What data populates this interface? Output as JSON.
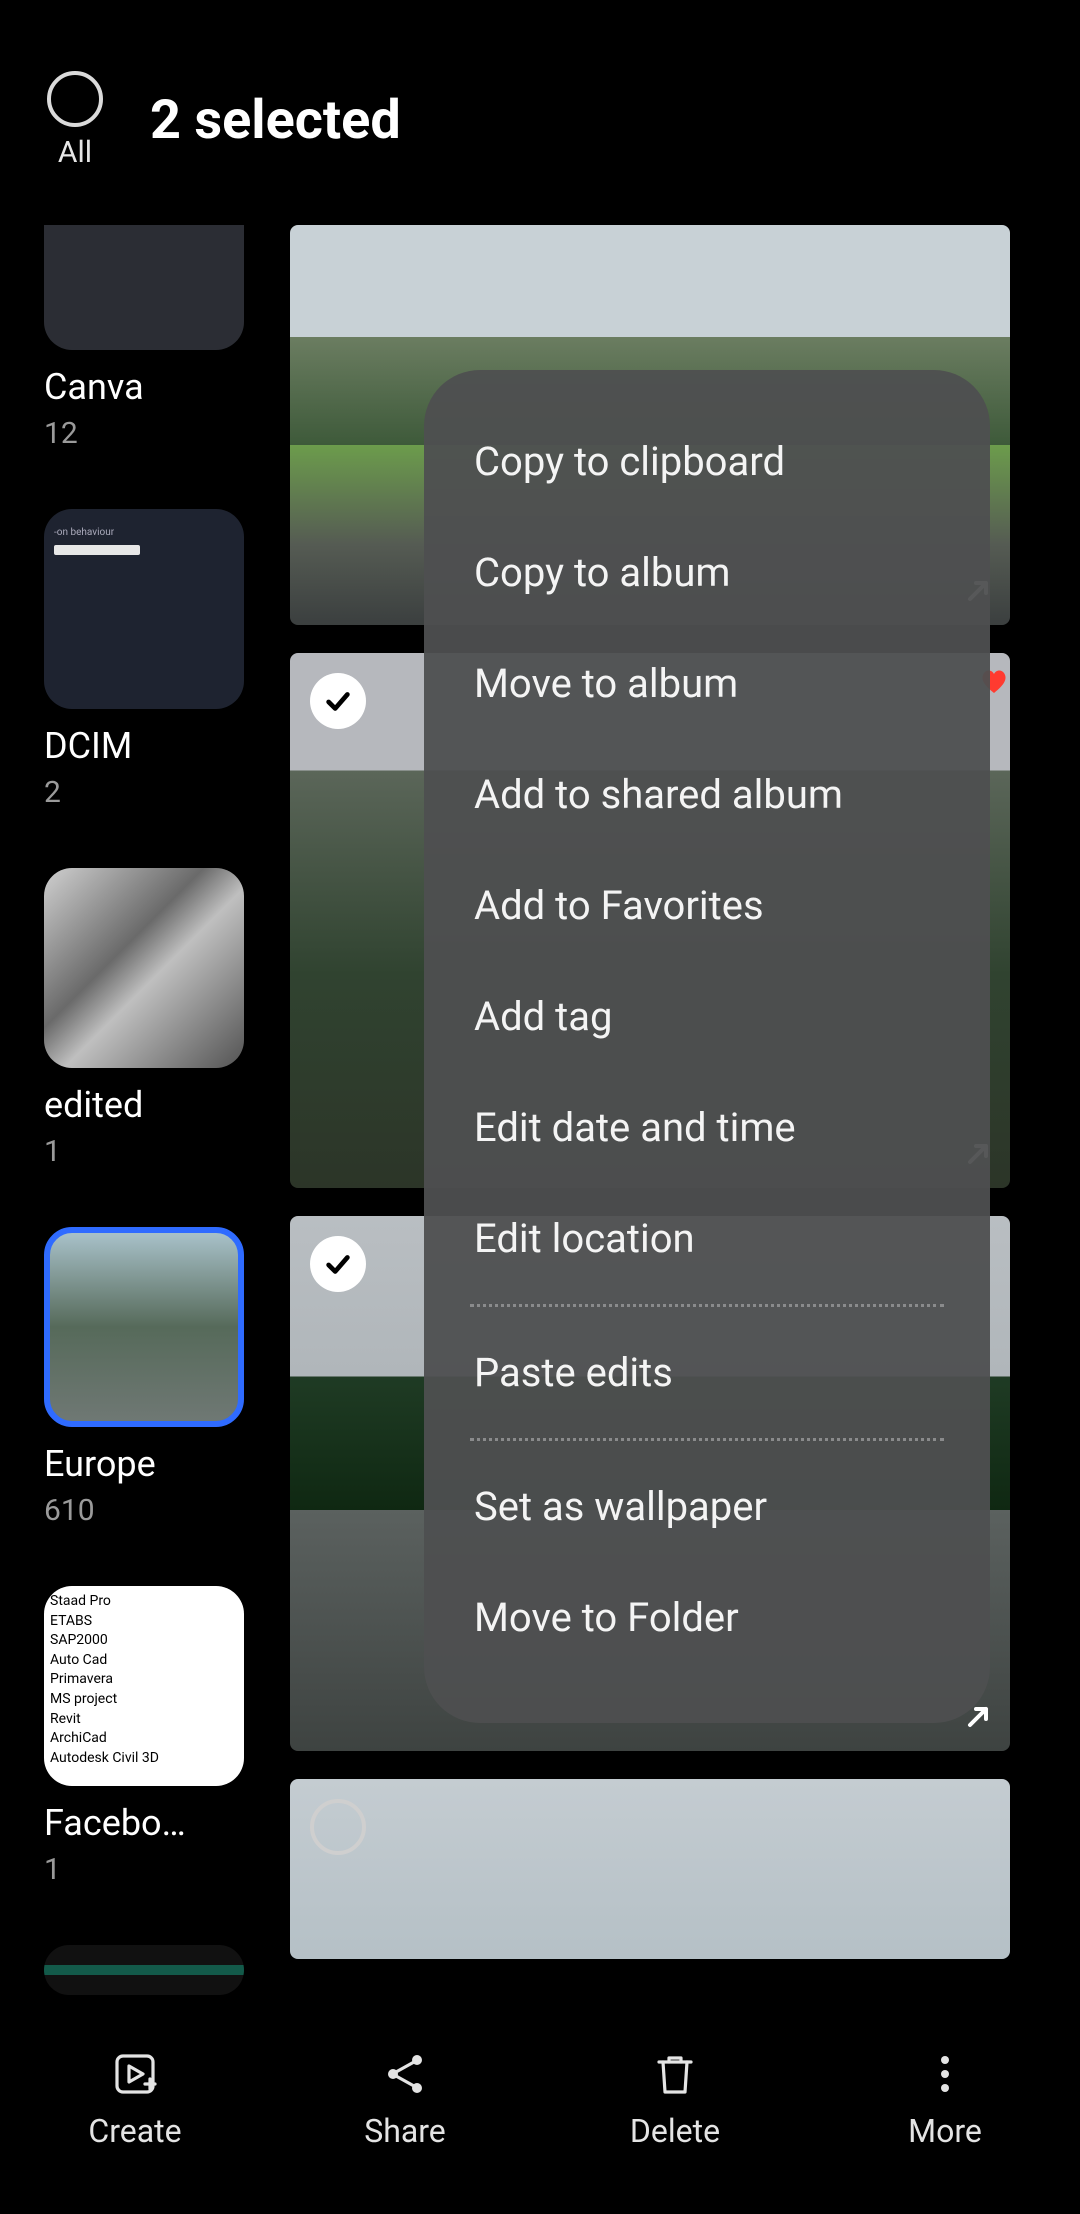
{
  "header": {
    "select_all_label": "All",
    "title": "2 selected"
  },
  "sidebar": {
    "albums": [
      {
        "name": "Canva",
        "count": "12",
        "thumb_class": "",
        "partial": true,
        "active": false
      },
      {
        "name": "DCIM",
        "count": "2",
        "thumb_class": "thumb-bg-dcim",
        "partial": false,
        "active": false
      },
      {
        "name": "edited",
        "count": "1",
        "thumb_class": "thumb-bg-edited",
        "partial": false,
        "active": false
      },
      {
        "name": "Europe",
        "count": "610",
        "thumb_class": "thumb-bg-europe",
        "partial": false,
        "active": true
      },
      {
        "name": "Facebo…",
        "count": "1",
        "thumb_class": "thumb-bg-facebook",
        "partial": false,
        "active": false
      }
    ]
  },
  "gallery": {
    "photos": [
      {
        "bg": "photo-mountain",
        "first": true,
        "selected": false,
        "share": true,
        "heart": false,
        "circle": false
      },
      {
        "bg": "photo-valley",
        "first": false,
        "selected": true,
        "share": true,
        "heart": true,
        "circle": false
      },
      {
        "bg": "photo-rain",
        "first": false,
        "selected": true,
        "share": true,
        "heart": false,
        "circle": false
      },
      {
        "bg": "photo-sky",
        "first": false,
        "selected": false,
        "share": false,
        "heart": false,
        "circle": true
      }
    ]
  },
  "popup": {
    "items_a": [
      "Copy to clipboard",
      "Copy to album",
      "Move to album",
      "Add to shared album",
      "Add to Favorites",
      "Add tag",
      "Edit date and time",
      "Edit location"
    ],
    "items_b": [
      "Paste edits"
    ],
    "items_c": [
      "Set as wallpaper",
      "Move to Folder"
    ]
  },
  "bottom_bar": {
    "create": "Create",
    "share": "Share",
    "delete": "Delete",
    "more": "More"
  }
}
